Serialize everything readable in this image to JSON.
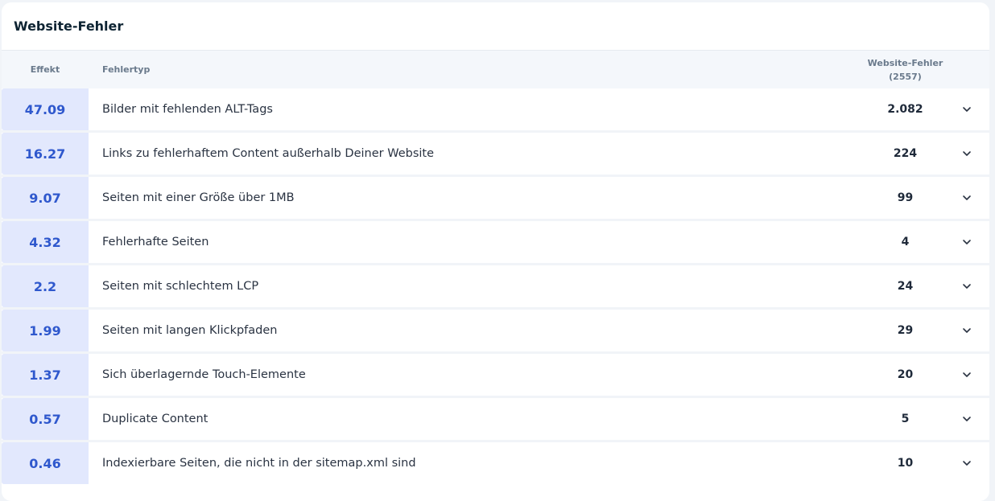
{
  "title": "Website-Fehler",
  "columns": {
    "effekt": "Effekt",
    "type": "Fehlertyp",
    "count_line1": "Website-Fehler",
    "count_line2": "(2557)"
  },
  "rows": [
    {
      "effekt": "47.09",
      "type": "Bilder mit fehlenden ALT-Tags",
      "count": "2.082"
    },
    {
      "effekt": "16.27",
      "type": "Links zu fehlerhaftem Content außerhalb Deiner Website",
      "count": "224"
    },
    {
      "effekt": "9.07",
      "type": "Seiten mit einer Größe über 1MB",
      "count": "99"
    },
    {
      "effekt": "4.32",
      "type": "Fehlerhafte Seiten",
      "count": "4"
    },
    {
      "effekt": "2.2",
      "type": "Seiten mit schlechtem LCP",
      "count": "24"
    },
    {
      "effekt": "1.99",
      "type": "Seiten mit langen Klickpfaden",
      "count": "29"
    },
    {
      "effekt": "1.37",
      "type": "Sich überlagernde Touch-Elemente",
      "count": "20"
    },
    {
      "effekt": "0.57",
      "type": "Duplicate Content",
      "count": "5"
    },
    {
      "effekt": "0.46",
      "type": "Indexierbare Seiten, die nicht in der sitemap.xml sind",
      "count": "10"
    }
  ],
  "icons": {
    "expand": "chevron-down-icon"
  },
  "colors": {
    "accent": "#2f58cd",
    "effekt_bg": "#e2e8fd"
  }
}
